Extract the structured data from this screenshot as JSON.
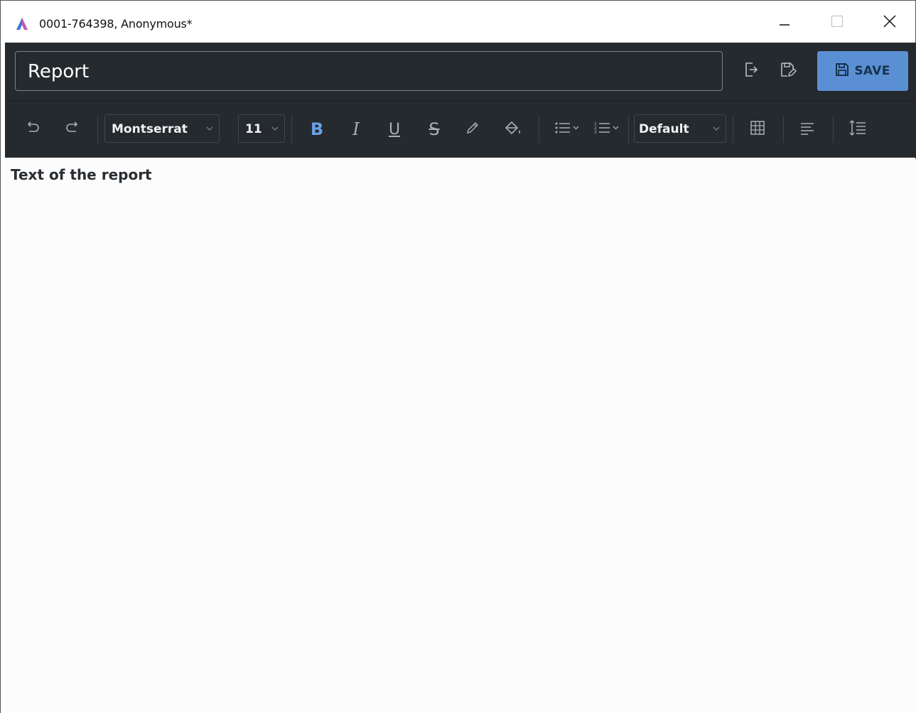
{
  "window": {
    "title": "0001-764398, Anonymous*",
    "controls": {
      "minimize_icon": "minimize-icon",
      "maximize_icon": "maximize-icon",
      "close_icon": "close-icon"
    }
  },
  "header": {
    "report_title": "Report",
    "export_icon": "export-icon",
    "save_as_icon": "save-as-icon",
    "save_label": "SAVE"
  },
  "toolbar": {
    "undo_icon": "undo-icon",
    "redo_icon": "redo-icon",
    "font_family": "Montserrat",
    "font_size": "11",
    "bold_label": "B",
    "bold_active": true,
    "italic_label": "I",
    "underline_label": "U",
    "strikethrough_label": "S",
    "pencil_icon": "pencil-icon",
    "fill_icon": "paint-bucket-icon",
    "bullet_list_icon": "bullet-list-icon",
    "numbered_list_icon": "numbered-list-icon",
    "paragraph_style": "Default",
    "table_icon": "table-icon",
    "align_icon": "align-left-icon",
    "line_spacing_icon": "line-spacing-icon"
  },
  "editor": {
    "content": "Text of the report"
  },
  "colors": {
    "dark_bg": "#252a2f",
    "accent": "#5b8fd4",
    "bold_active": "#6aa0e8",
    "icon": "#a9afb4",
    "editor_bg": "#fbfcfb"
  }
}
